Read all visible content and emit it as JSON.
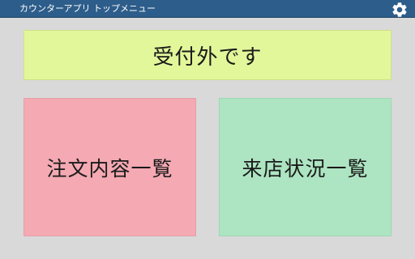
{
  "titlebar": {
    "title": "カウンターアプリ トップメニュー",
    "settings_icon": "gear-icon"
  },
  "main": {
    "status_label": "受付外です",
    "orders_label": "注文内容一覧",
    "visits_label": "来店状況一覧"
  },
  "colors": {
    "titlebar": "#2d5d8a",
    "background": "#d9d9d9",
    "status_panel": "#e2f79a",
    "orders_panel": "#f4a9b3",
    "visits_panel": "#ade5c2"
  }
}
